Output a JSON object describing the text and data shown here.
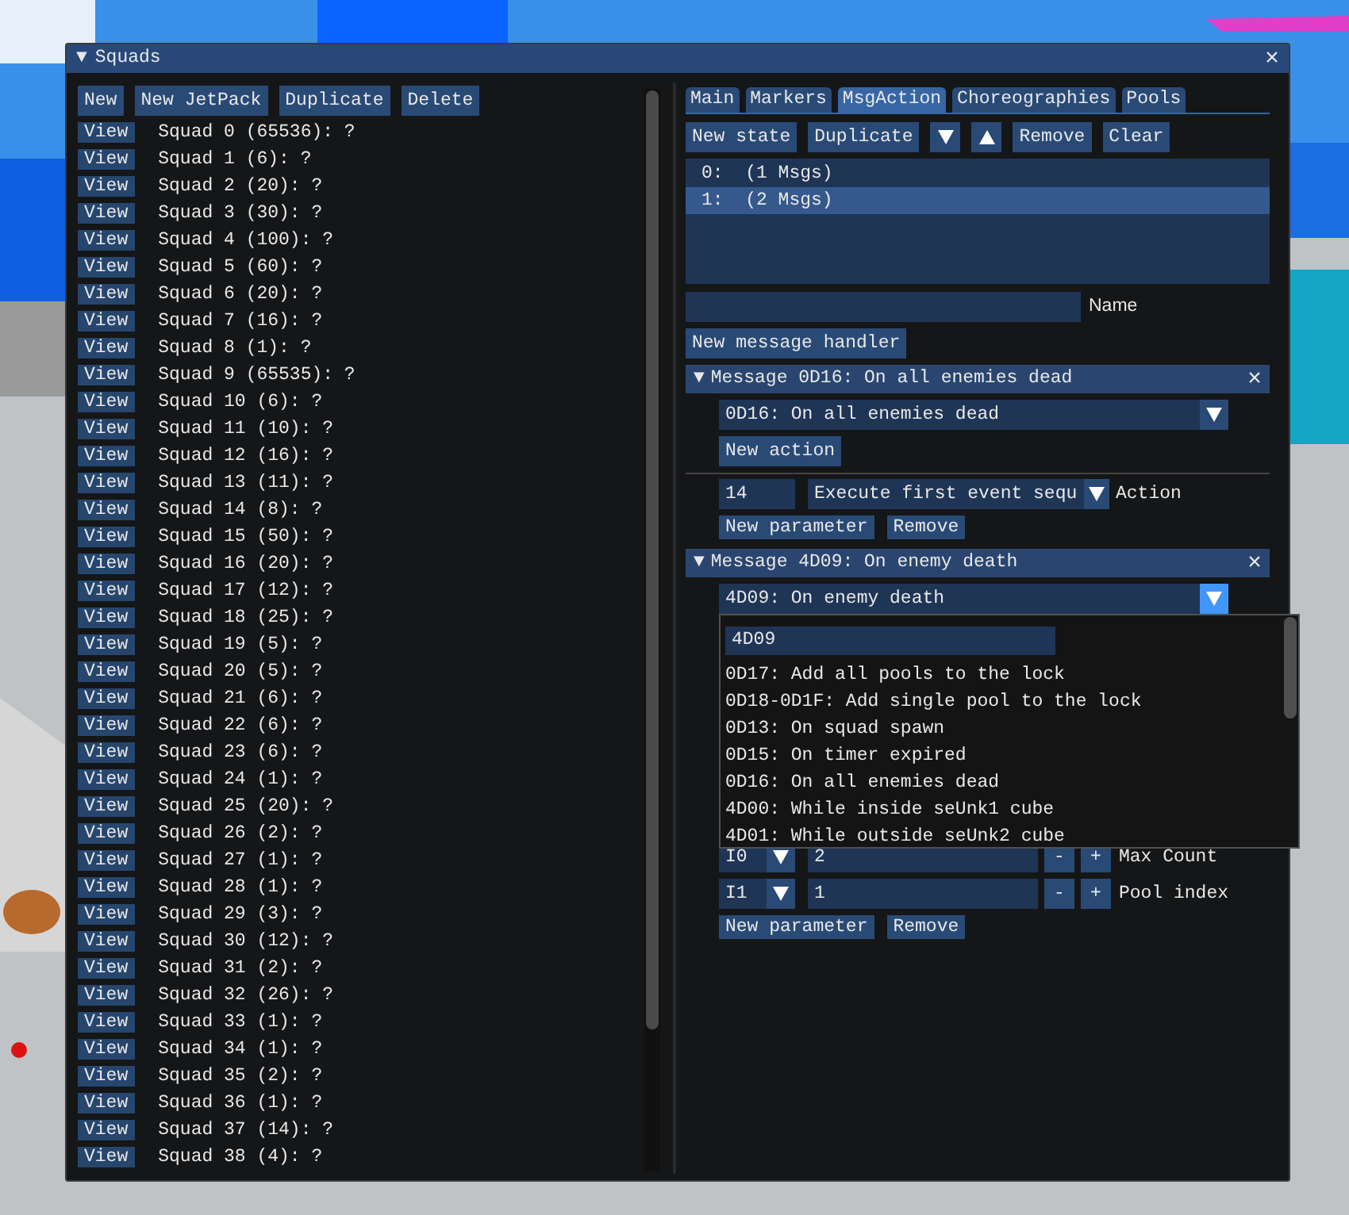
{
  "window": {
    "collapse": "▼",
    "title": "Squads",
    "close": "×"
  },
  "left": {
    "toolbar": [
      "New",
      "New JetPack",
      "Duplicate",
      "Delete"
    ],
    "squads": [
      {
        "button": "View",
        "label": "Squad 0 (65536): ?"
      },
      {
        "button": "View",
        "label": "Squad 1 (6): ?"
      },
      {
        "button": "View",
        "label": "Squad 2 (20): ?"
      },
      {
        "button": "View",
        "label": "Squad 3 (30): ?"
      },
      {
        "button": "View",
        "label": "Squad 4 (100): ?"
      },
      {
        "button": "View",
        "label": "Squad 5 (60): ?"
      },
      {
        "button": "View",
        "label": "Squad 6 (20): ?"
      },
      {
        "button": "View",
        "label": "Squad 7 (16): ?"
      },
      {
        "button": "View",
        "label": "Squad 8 (1): ?"
      },
      {
        "button": "View",
        "label": "Squad 9 (65535): ?"
      },
      {
        "button": "View",
        "label": "Squad 10 (6): ?"
      },
      {
        "button": "View",
        "label": "Squad 11 (10): ?"
      },
      {
        "button": "View",
        "label": "Squad 12 (16): ?"
      },
      {
        "button": "View",
        "label": "Squad 13 (11): ?"
      },
      {
        "button": "View",
        "label": "Squad 14 (8): ?"
      },
      {
        "button": "View",
        "label": "Squad 15 (50): ?"
      },
      {
        "button": "View",
        "label": "Squad 16 (20): ?"
      },
      {
        "button": "View",
        "label": "Squad 17 (12): ?"
      },
      {
        "button": "View",
        "label": "Squad 18 (25): ?"
      },
      {
        "button": "View",
        "label": "Squad 19 (5): ?"
      },
      {
        "button": "View",
        "label": "Squad 20 (5): ?"
      },
      {
        "button": "View",
        "label": "Squad 21 (6): ?"
      },
      {
        "button": "View",
        "label": "Squad 22 (6): ?"
      },
      {
        "button": "View",
        "label": "Squad 23 (6): ?"
      },
      {
        "button": "View",
        "label": "Squad 24 (1): ?"
      },
      {
        "button": "View",
        "label": "Squad 25 (20): ?"
      },
      {
        "button": "View",
        "label": "Squad 26 (2): ?"
      },
      {
        "button": "View",
        "label": "Squad 27 (1): ?"
      },
      {
        "button": "View",
        "label": "Squad 28 (1): ?"
      },
      {
        "button": "View",
        "label": "Squad 29 (3): ?"
      },
      {
        "button": "View",
        "label": "Squad 30 (12): ?"
      },
      {
        "button": "View",
        "label": "Squad 31 (2): ?"
      },
      {
        "button": "View",
        "label": "Squad 32 (26): ?"
      },
      {
        "button": "View",
        "label": "Squad 33 (1): ?"
      },
      {
        "button": "View",
        "label": "Squad 34 (1): ?"
      },
      {
        "button": "View",
        "label": "Squad 35 (2): ?"
      },
      {
        "button": "View",
        "label": "Squad 36 (1): ?"
      },
      {
        "button": "View",
        "label": "Squad 37 (14): ?"
      },
      {
        "button": "View",
        "label": "Squad 38 (4): ?"
      }
    ]
  },
  "right": {
    "tabs": [
      {
        "label": "Main",
        "selected": false
      },
      {
        "label": "Markers",
        "selected": false
      },
      {
        "label": "MsgAction",
        "selected": true
      },
      {
        "label": "Choreographies",
        "selected": false
      },
      {
        "label": "Pools",
        "selected": false
      }
    ],
    "state_toolbar": [
      {
        "kind": "text",
        "label": "New state"
      },
      {
        "kind": "text",
        "label": "Duplicate"
      },
      {
        "kind": "down"
      },
      {
        "kind": "up"
      },
      {
        "kind": "text",
        "label": "Remove"
      },
      {
        "kind": "text",
        "label": "Clear"
      }
    ],
    "states": [
      {
        "label": "0:  (1 Msgs)",
        "selected": false
      },
      {
        "label": "1:  (2 Msgs)",
        "selected": true
      }
    ],
    "name_field": {
      "label": "Name"
    },
    "new_handler_button": "New message handler",
    "messages": [
      {
        "toggle": "▼",
        "title": "Message 0D16: On all enemies dead",
        "close": "×",
        "combo": {
          "value": "0D16: On all enemies dead",
          "open": false
        },
        "new_action_button": "New action",
        "actions": [
          {
            "number": "14",
            "action": "Execute first event sequ",
            "label": "Action",
            "buttons": [
              "New parameter",
              "Remove"
            ]
          }
        ]
      },
      {
        "toggle": "▼",
        "title": "Message 4D09: On enemy death",
        "close": "×",
        "combo": {
          "value": "4D09: On enemy death",
          "open": true
        },
        "dropdown": {
          "filter": "4D09",
          "options": [
            "0D17: Add all pools to the lock",
            "0D18-0D1F: Add single pool to the lock",
            "0D13: On squad spawn",
            "0D15: On timer expired",
            "0D16: On all enemies dead",
            "4D00: While inside seUnk1 cube",
            "4D01: While outside seUnk2 cube"
          ]
        },
        "actions": [
          {
            "params": [
              {
                "type": "I0",
                "value": "2",
                "minus": "-",
                "plus": "+",
                "label": "Max Count"
              },
              {
                "type": "I1",
                "value": "1",
                "minus": "-",
                "plus": "+",
                "label": "Pool index"
              }
            ],
            "buttons": [
              "New parameter",
              "Remove"
            ]
          }
        ]
      }
    ]
  }
}
